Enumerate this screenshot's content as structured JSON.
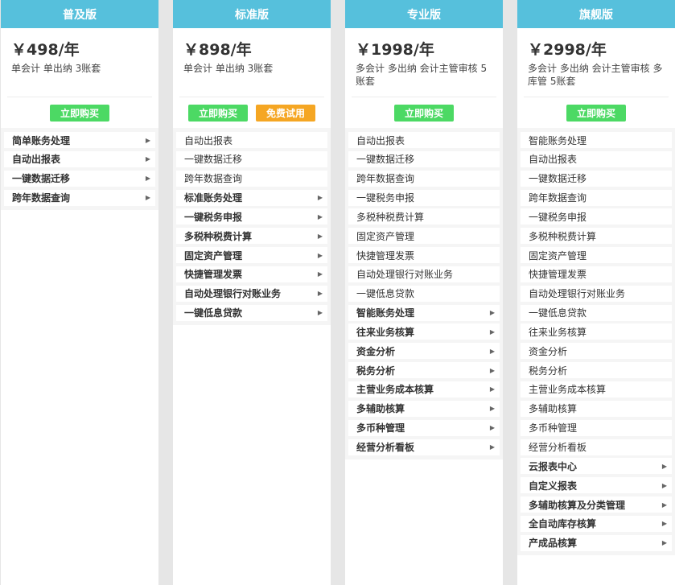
{
  "plans": [
    {
      "name": "普及版",
      "price": "￥498/年",
      "desc": "单会计 单出纳 3账套",
      "buy_label": "立即购买",
      "features": [
        {
          "label": "简单账务处理",
          "expandable": true
        },
        {
          "label": "自动出报表",
          "expandable": true
        },
        {
          "label": "一键数据迁移",
          "expandable": true
        },
        {
          "label": "跨年数据查询",
          "expandable": true
        }
      ]
    },
    {
      "name": "标准版",
      "price": "￥898/年",
      "desc": "单会计 单出纳 3账套",
      "buy_label": "立即购买",
      "trial_label": "免费试用",
      "features": [
        {
          "label": "自动出报表",
          "expandable": false
        },
        {
          "label": "一键数据迁移",
          "expandable": false
        },
        {
          "label": "跨年数据查询",
          "expandable": false
        },
        {
          "label": "标准账务处理",
          "expandable": true
        },
        {
          "label": "一键税务申报",
          "expandable": true
        },
        {
          "label": "多税种税费计算",
          "expandable": true
        },
        {
          "label": "固定资产管理",
          "expandable": true
        },
        {
          "label": "快捷管理发票",
          "expandable": true
        },
        {
          "label": "自动处理银行对账业务",
          "expandable": true
        },
        {
          "label": "一键低息贷款",
          "expandable": true
        }
      ]
    },
    {
      "name": "专业版",
      "price": "￥1998/年",
      "desc": "多会计 多出纳 会计主管审核 5账套",
      "buy_label": "立即购买",
      "features": [
        {
          "label": "自动出报表",
          "expandable": false
        },
        {
          "label": "一键数据迁移",
          "expandable": false
        },
        {
          "label": "跨年数据查询",
          "expandable": false
        },
        {
          "label": "一键税务申报",
          "expandable": false
        },
        {
          "label": "多税种税费计算",
          "expandable": false
        },
        {
          "label": "固定资产管理",
          "expandable": false
        },
        {
          "label": "快捷管理发票",
          "expandable": false
        },
        {
          "label": "自动处理银行对账业务",
          "expandable": false
        },
        {
          "label": "一键低息贷款",
          "expandable": false
        },
        {
          "label": "智能账务处理",
          "expandable": true
        },
        {
          "label": "往来业务核算",
          "expandable": true
        },
        {
          "label": "资金分析",
          "expandable": true
        },
        {
          "label": "税务分析",
          "expandable": true
        },
        {
          "label": "主营业务成本核算",
          "expandable": true
        },
        {
          "label": "多辅助核算",
          "expandable": true
        },
        {
          "label": "多币种管理",
          "expandable": true
        },
        {
          "label": "经营分析看板",
          "expandable": true
        }
      ]
    },
    {
      "name": "旗舰版",
      "price": "￥2998/年",
      "desc": "多会计 多出纳 会计主管审核 多库管 5账套",
      "buy_label": "立即购买",
      "features": [
        {
          "label": "智能账务处理",
          "expandable": false
        },
        {
          "label": "自动出报表",
          "expandable": false
        },
        {
          "label": "一键数据迁移",
          "expandable": false
        },
        {
          "label": "跨年数据查询",
          "expandable": false
        },
        {
          "label": "一键税务申报",
          "expandable": false
        },
        {
          "label": "多税种税费计算",
          "expandable": false
        },
        {
          "label": "固定资产管理",
          "expandable": false
        },
        {
          "label": "快捷管理发票",
          "expandable": false
        },
        {
          "label": "自动处理银行对账业务",
          "expandable": false
        },
        {
          "label": "一键低息贷款",
          "expandable": false
        },
        {
          "label": "往来业务核算",
          "expandable": false
        },
        {
          "label": "资金分析",
          "expandable": false
        },
        {
          "label": "税务分析",
          "expandable": false
        },
        {
          "label": "主营业务成本核算",
          "expandable": false
        },
        {
          "label": "多辅助核算",
          "expandable": false
        },
        {
          "label": "多币种管理",
          "expandable": false
        },
        {
          "label": "经营分析看板",
          "expandable": false
        },
        {
          "label": "云报表中心",
          "expandable": true
        },
        {
          "label": "自定义报表",
          "expandable": true
        },
        {
          "label": "多辅助核算及分类管理",
          "expandable": true
        },
        {
          "label": "全自动库存核算",
          "expandable": true
        },
        {
          "label": "产成品核算",
          "expandable": true
        }
      ]
    }
  ],
  "colors": {
    "header": "#56c0dc",
    "buy": "#4cd964",
    "trial": "#f5a623",
    "background": "#e6e6e6"
  },
  "icons": {
    "expand": "chevron-right-icon"
  }
}
